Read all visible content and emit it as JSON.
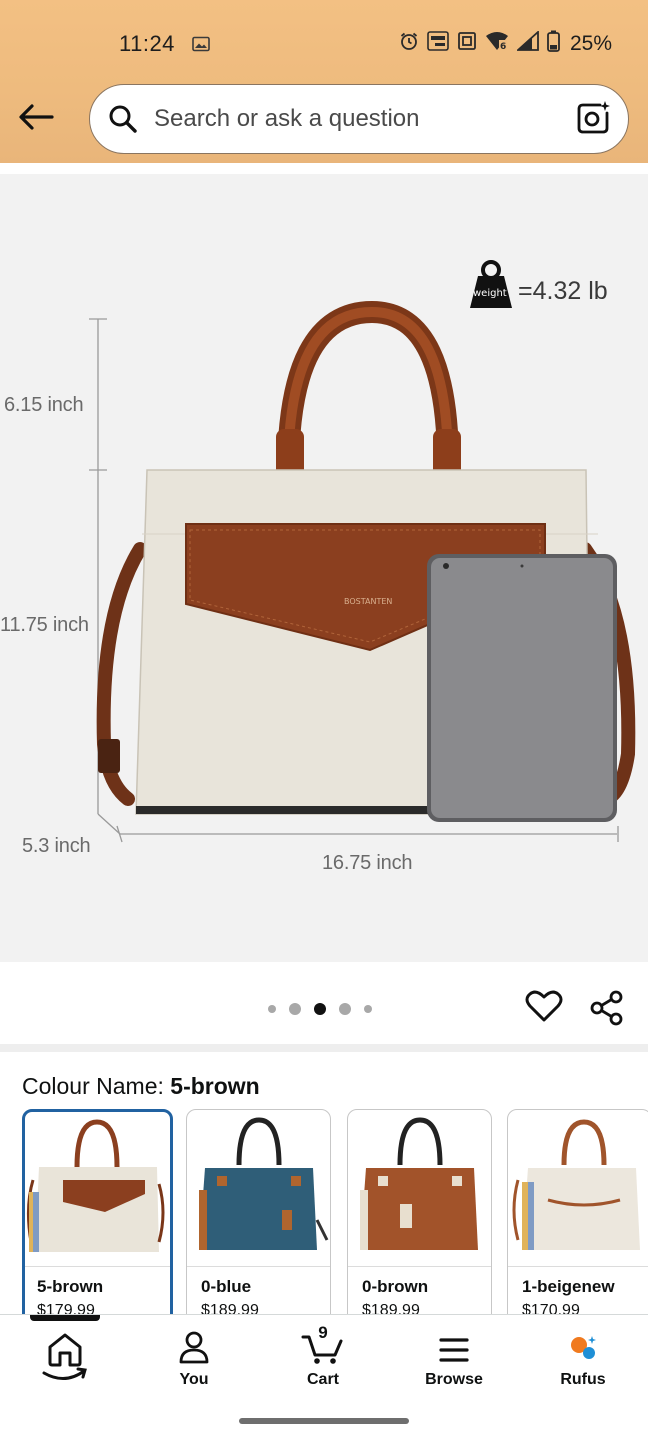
{
  "status_bar": {
    "time": "11:24",
    "battery_percent": "25%",
    "icons": [
      "image-icon",
      "alarm-icon",
      "auto-hz-icon",
      "nfc-icon",
      "wifi-6-icon",
      "signal-icon",
      "battery-icon"
    ]
  },
  "search": {
    "placeholder": "Search or ask a question"
  },
  "product_image": {
    "weight_label": "=4.32 lb",
    "weight_badge": "weight",
    "dimensions": {
      "handle_height": "6.15 inch",
      "height": "11.75 inch",
      "depth": "5.3 inch",
      "width": "16.75 inch"
    },
    "brand_on_bag": "BOSTANTEN",
    "carousel": {
      "total": 5,
      "active_index": 2
    }
  },
  "colour": {
    "label": "Colour Name: ",
    "selected": "5-brown",
    "options": [
      {
        "name": "5-brown",
        "price": "$179.99",
        "selected": true
      },
      {
        "name": "0-blue",
        "price": "$189.99",
        "selected": false
      },
      {
        "name": "0-brown",
        "price": "$189.99",
        "selected": false
      },
      {
        "name": "1-beigenew",
        "price": "$170.99",
        "selected": false
      }
    ]
  },
  "nav": {
    "items": [
      {
        "label": "",
        "icon": "home-icon",
        "active": true
      },
      {
        "label": "You",
        "icon": "person-icon",
        "active": false
      },
      {
        "label": "Cart",
        "icon": "cart-icon",
        "active": false,
        "count": "9"
      },
      {
        "label": "Browse",
        "icon": "menu-icon",
        "active": false
      },
      {
        "label": "Rufus",
        "icon": "rufus-icon",
        "active": false
      }
    ]
  },
  "colors": {
    "header": "#eebb7e",
    "accent_selected": "#2162a1",
    "bag_cream": "#e8e3d8",
    "bag_brown": "#8b3f1f",
    "tablet_gray": "#7d7d80"
  }
}
